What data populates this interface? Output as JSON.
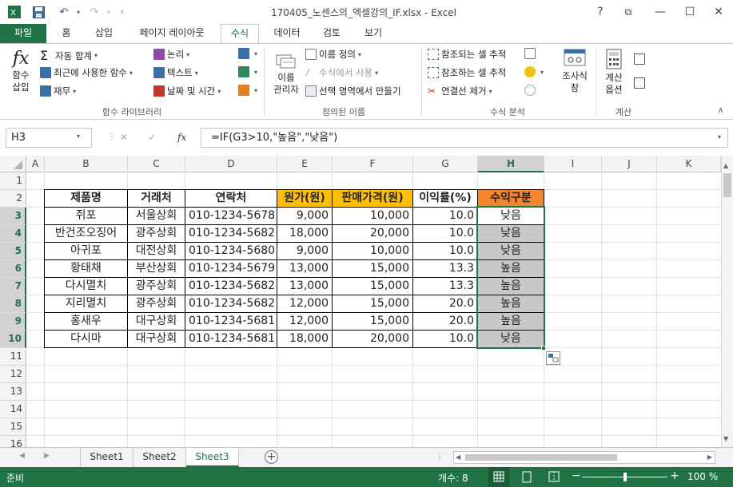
{
  "window": {
    "title": "170405_노센스의_엑셀강의_IF.xlsx - Excel",
    "help": "?",
    "minimize": "—",
    "maximize": "☐",
    "close": "✕"
  },
  "tabs": [
    "파일",
    "홈",
    "삽입",
    "페이지 레이아웃",
    "수식",
    "데이터",
    "검토",
    "보기"
  ],
  "ribbon": {
    "insert_function": [
      "함수",
      "삽입"
    ],
    "autosum": "자동 합계",
    "recent": "최근에 사용한 함수",
    "financial": "재무",
    "logical": "논리",
    "text": "텍스트",
    "datetime": "날짜 및 시간",
    "name_manager": [
      "이름",
      "관리자"
    ],
    "define_name": "이름 정의",
    "use_in_formula": "수식에서 사용",
    "create_from_selection": "선택 영역에서 만들기",
    "trace_precedents": "참조되는 셀 추적",
    "trace_dependents": "참조하는 셀 추적",
    "remove_arrows": "연결선 제거",
    "watch": [
      "조사식",
      "창"
    ],
    "calc_options": [
      "계산",
      "옵션"
    ],
    "groups": [
      "함수 라이브러리",
      "정의된 이름",
      "수식 분석",
      "계산"
    ]
  },
  "formula_bar": {
    "name_box": "H3",
    "formula": "=IF(G3>10,\"높음\",\"낮음\")",
    "cancel": "✕",
    "enter": "✓",
    "fx": "fx"
  },
  "columns": [
    "A",
    "B",
    "C",
    "D",
    "E",
    "F",
    "G",
    "H",
    "I",
    "J",
    "K"
  ],
  "rows": [
    "1",
    "2",
    "3",
    "4",
    "5",
    "6",
    "7",
    "8",
    "9",
    "10",
    "11",
    "12",
    "13",
    "14",
    "15",
    "16"
  ],
  "table": {
    "headers": [
      "제품명",
      "거래처",
      "연락처",
      "원가(원)",
      "판매가격(원)",
      "이익률(%)",
      "수익구분"
    ],
    "data": [
      [
        "쥐포",
        "서울상회",
        "010-1234-5678",
        "9,000",
        "10,000",
        "10.0",
        "낮음"
      ],
      [
        "반건조오징어",
        "광주상회",
        "010-1234-5682",
        "18,000",
        "20,000",
        "10.0",
        "낮음"
      ],
      [
        "아귀포",
        "대전상회",
        "010-1234-5680",
        "9,000",
        "10,000",
        "10.0",
        "낮음"
      ],
      [
        "황태채",
        "부산상회",
        "010-1234-5679",
        "13,000",
        "15,000",
        "13.3",
        "높음"
      ],
      [
        "다시멸치",
        "광주상회",
        "010-1234-5682",
        "13,000",
        "15,000",
        "13.3",
        "높음"
      ],
      [
        "지리멸치",
        "광주상회",
        "010-1234-5682",
        "12,000",
        "15,000",
        "20.0",
        "높음"
      ],
      [
        "홍새우",
        "대구상회",
        "010-1234-5681",
        "12,000",
        "15,000",
        "20.0",
        "높음"
      ],
      [
        "다시마",
        "대구상회",
        "010-1234-5681",
        "18,000",
        "20,000",
        "10.0",
        "낮음"
      ]
    ]
  },
  "sheets": [
    "Sheet1",
    "Sheet2",
    "Sheet3"
  ],
  "active_sheet": "Sheet3",
  "status": {
    "ready": "준비",
    "count": "개수: 8",
    "zoom": "100 %"
  },
  "colors": {
    "excel_green": "#217346",
    "header_yellow": "#ffc000",
    "header_orange": "#f4842e",
    "selection_gray": "#c8c8c8"
  }
}
